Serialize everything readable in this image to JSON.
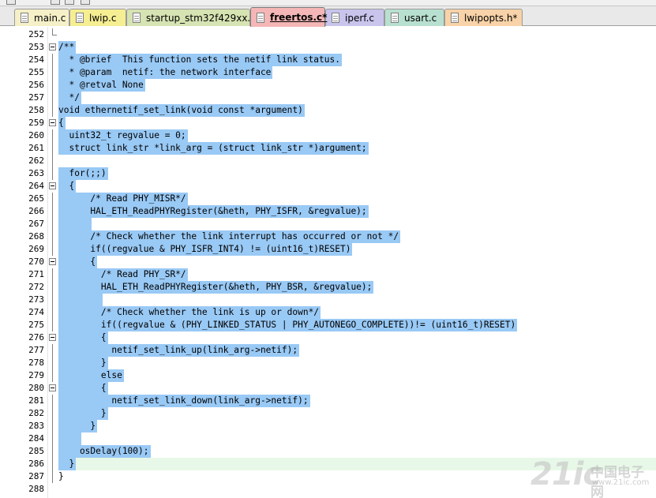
{
  "tabs": [
    {
      "label": "main.c",
      "color": "#f5f0c8",
      "active": false
    },
    {
      "label": "lwip.c",
      "color": "#f6ee92",
      "active": false
    },
    {
      "label": "startup_stm32f429xx.s",
      "color": "#d6e3b2",
      "active": false
    },
    {
      "label": "freertos.c*",
      "color": "#f4b6b6",
      "active": true
    },
    {
      "label": "iperf.c",
      "color": "#c8c4ec",
      "active": false
    },
    {
      "label": "usart.c",
      "color": "#b8e0d0",
      "active": false
    },
    {
      "label": "lwipopts.h*",
      "color": "#f8d2a8",
      "active": false
    }
  ],
  "editor": {
    "lines": [
      {
        "n": "252",
        "text": ""
      },
      {
        "n": "253",
        "text": "/**"
      },
      {
        "n": "254",
        "text": "  * @brief  This function sets the netif link status."
      },
      {
        "n": "255",
        "text": "  * @param  netif: the network interface"
      },
      {
        "n": "256",
        "text": "  * @retval None"
      },
      {
        "n": "257",
        "text": "  */"
      },
      {
        "n": "258",
        "text": "void ethernetif_set_link(void const *argument)"
      },
      {
        "n": "259",
        "text": "{"
      },
      {
        "n": "260",
        "text": "  uint32_t regvalue = 0;"
      },
      {
        "n": "261",
        "text": "  struct link_str *link_arg = (struct link_str *)argument;"
      },
      {
        "n": "262",
        "text": ""
      },
      {
        "n": "263",
        "text": "  for(;;)"
      },
      {
        "n": "264",
        "text": "  {"
      },
      {
        "n": "265",
        "text": "      /* Read PHY_MISR*/"
      },
      {
        "n": "266",
        "text": "      HAL_ETH_ReadPHYRegister(&heth, PHY_ISFR, &regvalue);"
      },
      {
        "n": "267",
        "text": "      "
      },
      {
        "n": "268",
        "text": "      /* Check whether the link interrupt has occurred or not */"
      },
      {
        "n": "269",
        "text": "      if((regvalue & PHY_ISFR_INT4) != (uint16_t)RESET)"
      },
      {
        "n": "270",
        "text": "      {"
      },
      {
        "n": "271",
        "text": "        /* Read PHY_SR*/"
      },
      {
        "n": "272",
        "text": "        HAL_ETH_ReadPHYRegister(&heth, PHY_BSR, &regvalue);"
      },
      {
        "n": "273",
        "text": "        "
      },
      {
        "n": "274",
        "text": "        /* Check whether the link is up or down*/"
      },
      {
        "n": "275",
        "text": "        if((regvalue & (PHY_LINKED_STATUS | PHY_AUTONEGO_COMPLETE))!= (uint16_t)RESET)"
      },
      {
        "n": "276",
        "text": "        {"
      },
      {
        "n": "277",
        "text": "          netif_set_link_up(link_arg->netif);"
      },
      {
        "n": "278",
        "text": "        }"
      },
      {
        "n": "279",
        "text": "        else"
      },
      {
        "n": "280",
        "text": "        {"
      },
      {
        "n": "281",
        "text": "          netif_set_link_down(link_arg->netif);"
      },
      {
        "n": "282",
        "text": "        }"
      },
      {
        "n": "283",
        "text": "      }"
      },
      {
        "n": "284",
        "text": "    "
      },
      {
        "n": "285",
        "text": "    osDelay(100);"
      },
      {
        "n": "286",
        "text": "  }"
      },
      {
        "n": "287",
        "text": "}"
      },
      {
        "n": "288",
        "text": ""
      }
    ],
    "selection_color": "#99c9f5",
    "current_line_color": "#e8f8e8",
    "fold_markers": [
      "253",
      "259",
      "264",
      "270",
      "276",
      "280"
    ]
  },
  "watermark": {
    "logo": "21ic",
    "brand_cn": "中国电子网",
    "url": "www.21ic.com"
  }
}
